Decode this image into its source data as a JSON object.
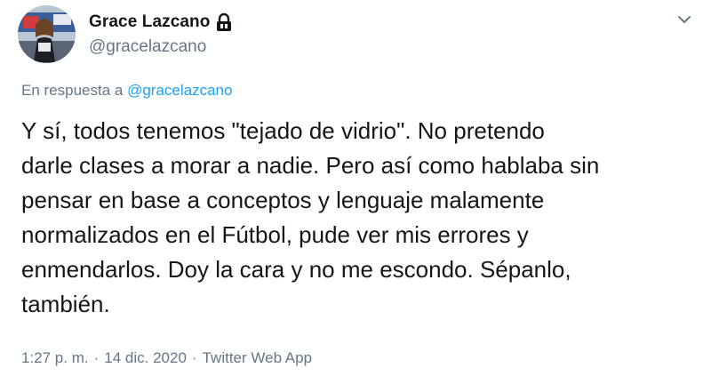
{
  "user": {
    "display_name": "Grace Lazcano",
    "handle": "@gracelazcano",
    "protected_icon": "lock-icon",
    "avatar_icon": "avatar"
  },
  "menu": {
    "icon": "chevron-down-icon"
  },
  "reply": {
    "prefix": "En respuesta a",
    "handle": "@gracelazcano"
  },
  "tweet": {
    "lines": [
      "Y sí, todos tenemos \"tejado de vidrio\". No pretendo",
      "darle clases a morar a nadie. Pero así como hablaba sin",
      "pensar en base a conceptos y lenguaje malamente",
      "normalizados en el Fútbol, pude ver mis errores y",
      "enmendarlos. Doy la cara y no me escondo. Sépanlo,",
      "también."
    ]
  },
  "meta": {
    "time": "1:27 p. m.",
    "date": "14 dic. 2020",
    "source": "Twitter Web App",
    "separator": "·"
  },
  "colors": {
    "text": "#14171a",
    "secondary": "#657786",
    "link": "#1da1f2"
  }
}
